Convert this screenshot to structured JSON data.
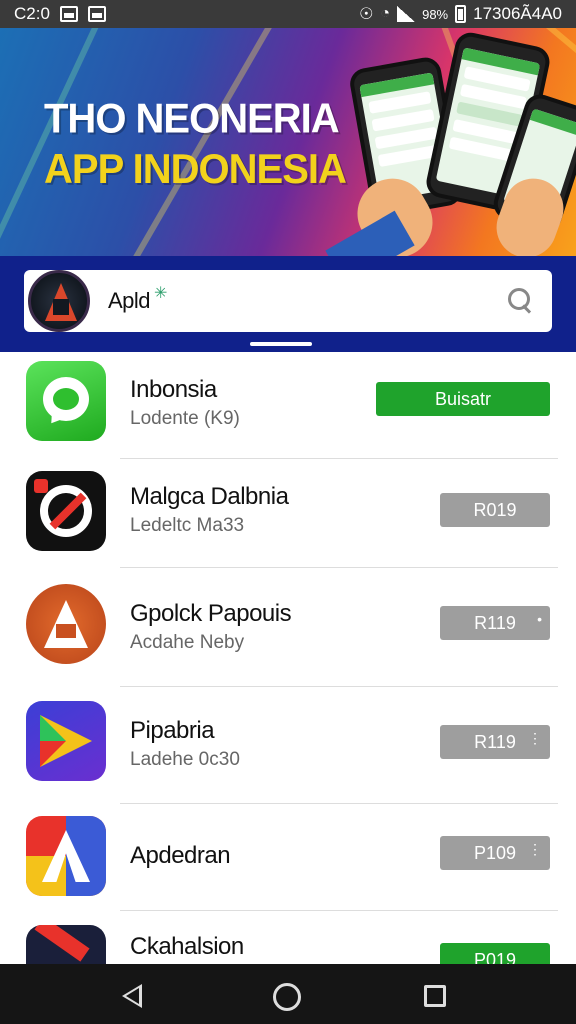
{
  "status_bar": {
    "time": "C2:0",
    "battery_percent": "98%",
    "right_clock": "17306Ã4A0"
  },
  "banner": {
    "line1": "THO NEONERIA",
    "line2": "APP INDONESIA",
    "accent_color": "#f2d21c"
  },
  "search": {
    "value": "Apld",
    "icon": "search-icon"
  },
  "apps": [
    {
      "name": "Inbonsia",
      "subtitle": "Lodente (K9)",
      "button": "Buisatr",
      "button_color": "#1fa32c"
    },
    {
      "name": "Malgca Dalbnia",
      "subtitle": "Ledeltc Ma33",
      "button": "R019",
      "button_color": "#9e9e9e"
    },
    {
      "name": "Gpolck Papouis",
      "subtitle": "Acdahe Neby",
      "button": "R119",
      "button_color": "#9e9e9e"
    },
    {
      "name": "Pipabria",
      "subtitle": "Ladehe 0c30",
      "button": "R119",
      "button_color": "#9e9e9e"
    },
    {
      "name": "Apdedran",
      "subtitle": "",
      "button": "P109",
      "button_color": "#9e9e9e"
    },
    {
      "name": "Ckahalsion",
      "subtitle": "",
      "button": "P019",
      "button_color": "#1fa32c"
    }
  ],
  "nav": {
    "back": "back-icon",
    "home": "home-icon",
    "recent": "recent-apps-icon"
  }
}
